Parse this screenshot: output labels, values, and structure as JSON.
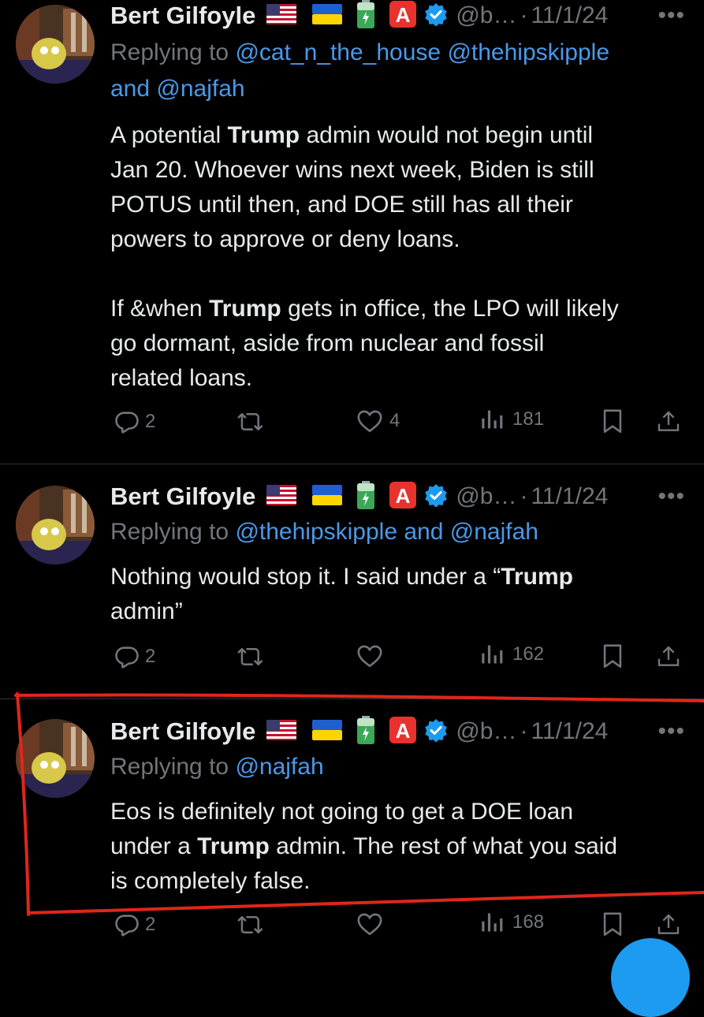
{
  "tweets": [
    {
      "author": "Bert Gilfoyle",
      "handle": "@b…",
      "date": "11/1/24",
      "replying_prefix": "Replying to ",
      "replying_to": [
        "@cat_n_the_house",
        "@thehipskipple",
        "and",
        "@najfah"
      ],
      "body_lines": [
        [
          {
            "t": "A potential "
          },
          {
            "t": "Trump",
            "b": true
          },
          {
            "t": " admin would not begin until"
          }
        ],
        [
          {
            "t": "Jan 20. Whoever wins next week, Biden is still"
          }
        ],
        [
          {
            "t": "POTUS until then, and DOE still has all their"
          }
        ],
        [
          {
            "t": "powers to approve or deny loans."
          }
        ],
        [
          {
            "t": ""
          }
        ],
        [
          {
            "t": "If &when "
          },
          {
            "t": "Trump",
            "b": true
          },
          {
            "t": " gets in office, the LPO will likely"
          }
        ],
        [
          {
            "t": "go dormant, aside from nuclear and fossil"
          }
        ],
        [
          {
            "t": "related loans."
          }
        ]
      ],
      "replies": "2",
      "retweets": "",
      "likes": "4",
      "views": "181"
    },
    {
      "author": "Bert Gilfoyle",
      "handle": "@b…",
      "date": "11/1/24",
      "replying_prefix": "Replying to ",
      "replying_to": [
        "@thehipskipple",
        "and",
        "@najfah"
      ],
      "body_lines": [
        [
          {
            "t": "Nothing would stop it. I said under a “"
          },
          {
            "t": "Trump",
            "b": true
          }
        ],
        [
          {
            "t": "admin”"
          }
        ]
      ],
      "replies": "2",
      "retweets": "",
      "likes": "",
      "views": "162"
    },
    {
      "author": "Bert Gilfoyle",
      "handle": "@b…",
      "date": "11/1/24",
      "replying_prefix": "Replying to ",
      "replying_to": [
        "@najfah"
      ],
      "body_lines": [
        [
          {
            "t": "Eos is definitely not going to get a DOE loan"
          }
        ],
        [
          {
            "t": "under a "
          },
          {
            "t": "Trump",
            "b": true
          },
          {
            "t": " admin. The rest of what you said"
          }
        ],
        [
          {
            "t": "is completely false."
          }
        ]
      ],
      "replies": "2",
      "retweets": "",
      "likes": "",
      "views": "168"
    }
  ],
  "badges": [
    "us-flag",
    "ukraine-flag",
    "battery-emoji",
    "red-a-emoji",
    "verified-badge"
  ],
  "colors": {
    "background": "#000000",
    "text": "#e7e9ea",
    "muted": "#71767b",
    "link": "#4a99e9",
    "verified": "#1d9bf0",
    "annotation": "#e0261b"
  }
}
